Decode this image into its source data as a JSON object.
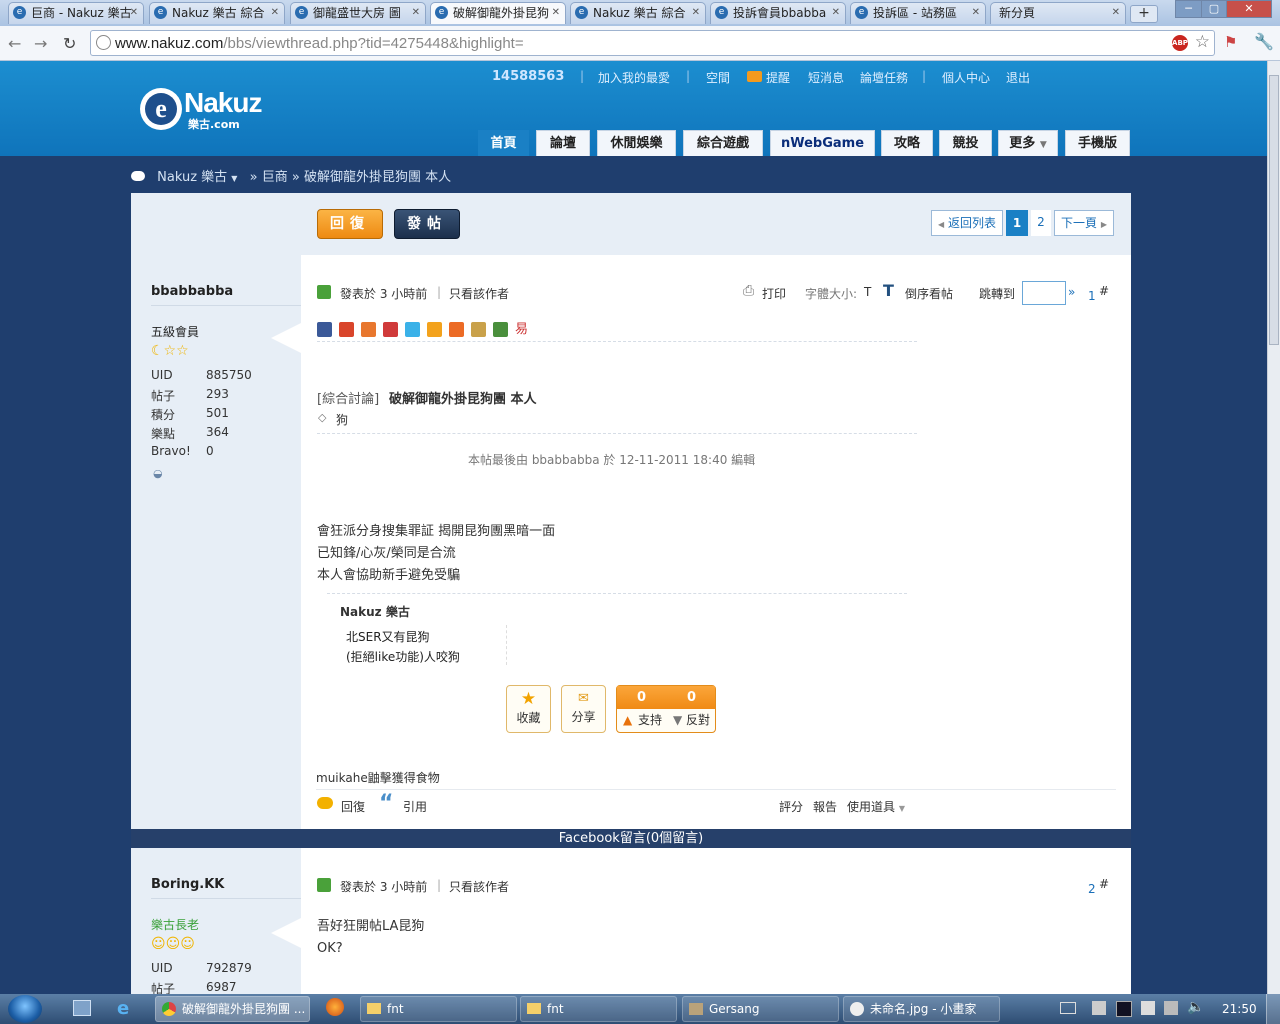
{
  "browser": {
    "tabs": [
      {
        "title": "巨商 - Nakuz 樂古"
      },
      {
        "title": "Nakuz 樂古 綜合"
      },
      {
        "title": "御龍盛世大房 圖"
      },
      {
        "title": "破解御龍外掛昆狗"
      },
      {
        "title": "Nakuz 樂古 綜合"
      },
      {
        "title": "投訴會員bbabba"
      },
      {
        "title": "投訴區 - 站務區"
      },
      {
        "title": "新分頁"
      }
    ],
    "url_domain": "www.nakuz.com",
    "url_path": "/bbs/viewthread.php?tid=4275448&highlight="
  },
  "header": {
    "logo_text": "Nakuz",
    "logo_sub": "樂古.com",
    "user_id": "14588563",
    "links": [
      "加入我的最愛",
      "空間",
      "提醒",
      "短消息",
      "論壇任務",
      "個人中心",
      "退出"
    ],
    "nav": [
      "首頁",
      "論壇",
      "休閒娛樂",
      "綜合遊戲",
      "nWebGame",
      "攻略",
      "競投",
      "更多",
      "手機版"
    ]
  },
  "breadcrumb": {
    "site": "Nakuz 樂古",
    "forum": "巨商",
    "thread": "破解御龍外掛昆狗團 本人"
  },
  "thread_actions": {
    "reply": "回復",
    "post": "發帖"
  },
  "pagination": {
    "back": "返回列表",
    "pages": [
      "1",
      "2"
    ],
    "next": "下一頁"
  },
  "post1": {
    "author": "bbabbabba",
    "rank": "五級會員",
    "stats": [
      {
        "label": "UID",
        "value": "885750"
      },
      {
        "label": "帖子",
        "value": "293"
      },
      {
        "label": "積分",
        "value": "501"
      },
      {
        "label": "樂點",
        "value": "364"
      },
      {
        "label": "Bravo!",
        "value": "0"
      }
    ],
    "posted": "發表於 3 小時前",
    "only_author": "只看該作者",
    "print": "打印",
    "font_size": "字體大小:",
    "font_t": "T",
    "reverse": "倒序看帖",
    "jump": "跳轉到",
    "jump_go": "»",
    "floor": "1",
    "floor_sign": "#",
    "category": "[綜合討論]",
    "title": "破解御龍外掛昆狗團 本人",
    "tag": "狗",
    "edit_note": "本帖最後由 bbabbabba 於 12-11-2011 18:40 編輯",
    "body": [
      "會狂派分身搜集罪証 揭開昆狗團黑暗一面",
      "已知鋒/心灰/榮同是合流",
      "本人會協助新手避免受騙"
    ],
    "sig_name": "Nakuz 樂古",
    "sig_lines": [
      "北SER又有昆狗",
      "(拒絕like功能)人咬狗"
    ],
    "fav": "收藏",
    "share": "分享",
    "support_count": "0",
    "oppose_count": "0",
    "support": "支持",
    "oppose": "反對",
    "footer_note": "muikahe鼬擊獲得食物",
    "reply": "回復",
    "quote": "引用",
    "rate": "評分",
    "report": "報告",
    "tools": "使用道具"
  },
  "facebook_bar": "Facebook留言(0個留言)",
  "post2": {
    "author": "Boring.KK",
    "rank": "樂古長老",
    "stats": [
      {
        "label": "UID",
        "value": "792879"
      },
      {
        "label": "帖子",
        "value": "6987"
      }
    ],
    "posted": "發表於 3 小時前",
    "only_author": "只看該作者",
    "floor": "2",
    "floor_sign": "#",
    "body": [
      "吾好狂開帖LA昆狗",
      "OK?"
    ]
  },
  "taskbar": {
    "tasks": [
      "破解御龍外掛昆狗團 ...",
      "fnt",
      "fnt",
      "Gersang",
      "未命名.jpg - 小畫家"
    ],
    "clock": "21:50"
  },
  "colors": {
    "header_blue": "#1584c8",
    "navy": "#1f3e6e",
    "orange": "#f29a1c"
  }
}
